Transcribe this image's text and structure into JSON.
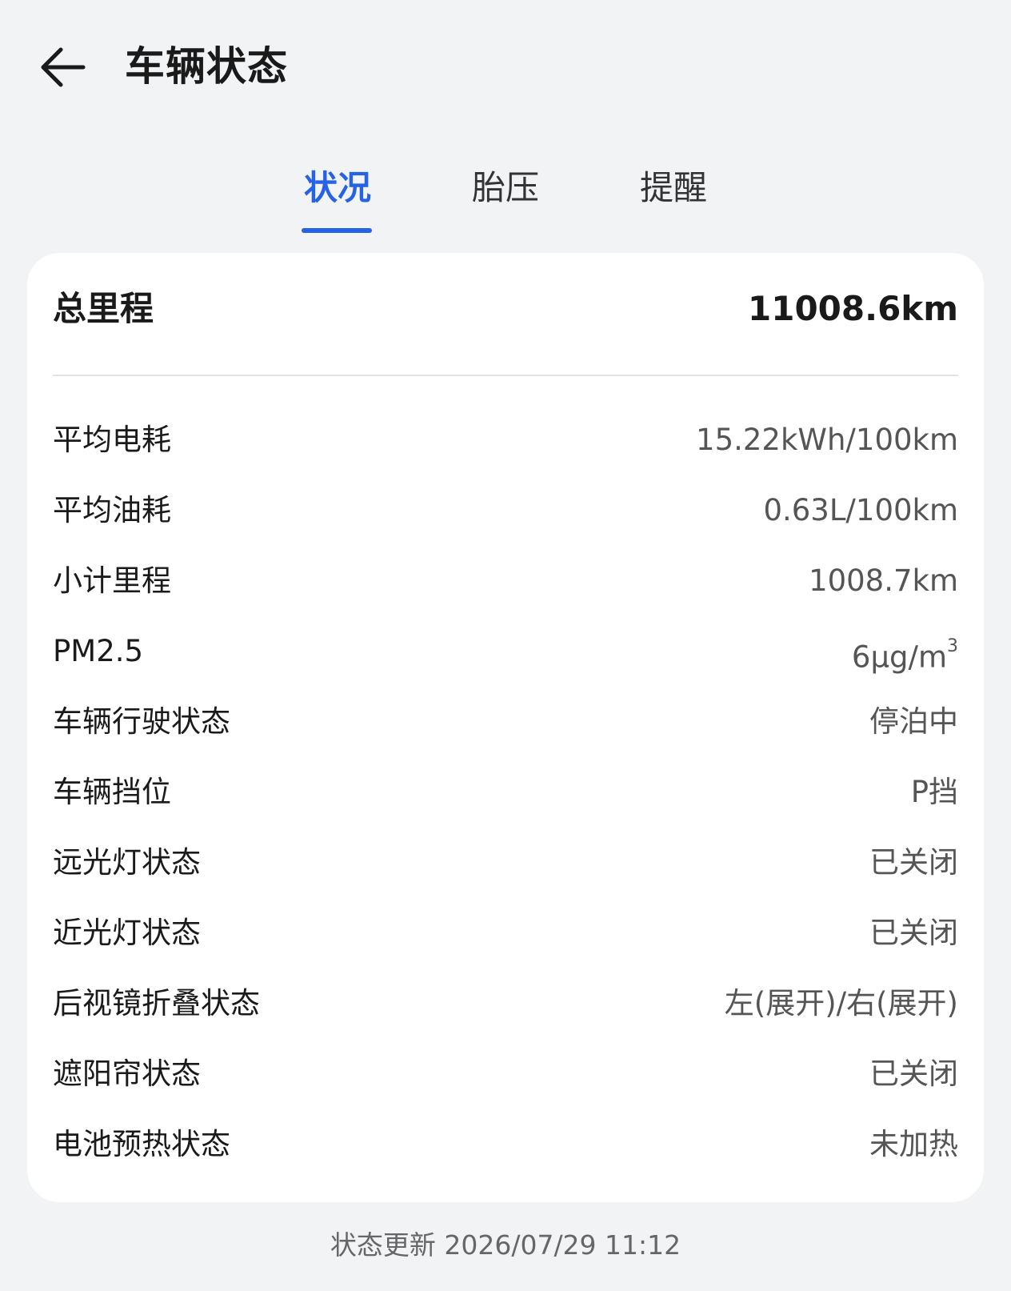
{
  "header": {
    "back_icon": "arrow-left-icon",
    "title": "车辆状态"
  },
  "tabs": [
    {
      "label": "状况",
      "active": true
    },
    {
      "label": "胎压",
      "active": false
    },
    {
      "label": "提醒",
      "active": false
    }
  ],
  "colors": {
    "accent": "#2762e6",
    "background": "#f1f3f5",
    "card": "#ffffff"
  },
  "summary": {
    "label": "总里程",
    "value": "11008.6km"
  },
  "rows": [
    {
      "label": "平均电耗",
      "value": "15.22kWh/100km"
    },
    {
      "label": "平均油耗",
      "value": "0.63L/100km"
    },
    {
      "label": "小计里程",
      "value": "1008.7km"
    },
    {
      "label": "PM2.5",
      "value": "6μg/m",
      "superscript": "3"
    },
    {
      "label": "车辆行驶状态",
      "value": "停泊中"
    },
    {
      "label": "车辆挡位",
      "value": "P挡"
    },
    {
      "label": "远光灯状态",
      "value": "已关闭"
    },
    {
      "label": "近光灯状态",
      "value": "已关闭"
    },
    {
      "label": "后视镜折叠状态",
      "value": "左(展开)/右(展开)"
    },
    {
      "label": "遮阳帘状态",
      "value": "已关闭"
    },
    {
      "label": "电池预热状态",
      "value": "未加热"
    }
  ],
  "footer": {
    "update_text": "状态更新 2026/07/29 11:12"
  }
}
